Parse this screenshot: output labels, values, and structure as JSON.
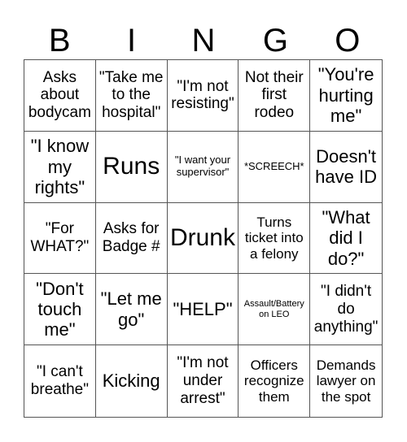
{
  "header": {
    "letters": [
      "B",
      "I",
      "N",
      "G",
      "O"
    ]
  },
  "board": {
    "rows": [
      [
        "Asks about bodycam",
        "\"Take me to the hospital\"",
        "\"I'm not resisting\"",
        "Not their first rodeo",
        "\"You're hurting me\""
      ],
      [
        "\"I know my rights\"",
        "Runs",
        "\"I want your supervisor\"",
        "*SCREECH*",
        "Doesn't have ID"
      ],
      [
        "\"For WHAT?\"",
        "Asks for Badge #",
        "Drunk",
        "Turns ticket into a felony",
        "\"What did I do?\""
      ],
      [
        "\"Don't touch me\"",
        "\"Let me go\"",
        "\"HELP\"",
        "Assault/Battery on LEO",
        "\"I didn't do anything\""
      ],
      [
        "\"I can't breathe\"",
        "Kicking",
        "\"I'm not under arrest\"",
        "Officers recognize them",
        "Demands lawyer on the spot"
      ]
    ]
  }
}
